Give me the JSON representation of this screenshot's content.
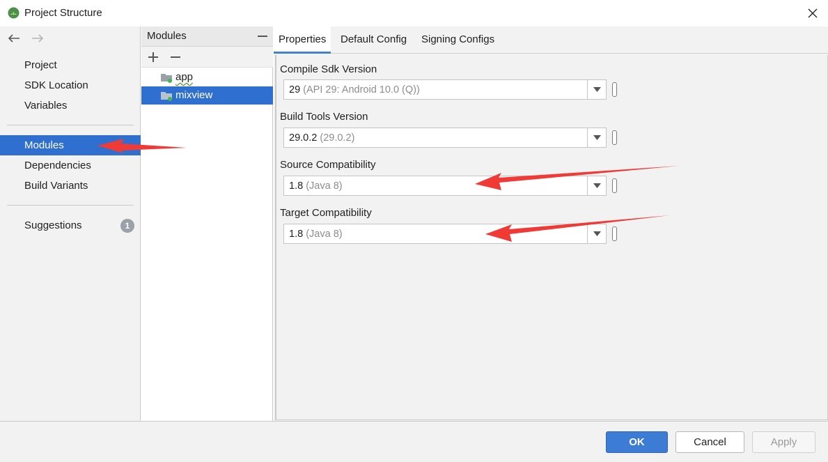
{
  "window": {
    "title": "Project Structure"
  },
  "sidebar": {
    "items": [
      {
        "label": "Project"
      },
      {
        "label": "SDK Location"
      },
      {
        "label": "Variables"
      },
      {
        "label": "Modules",
        "selected": true
      },
      {
        "label": "Dependencies"
      },
      {
        "label": "Build Variants"
      },
      {
        "label": "Suggestions",
        "badge": "1"
      }
    ]
  },
  "modules": {
    "header": "Modules",
    "items": [
      {
        "label": "app"
      },
      {
        "label": "mixview",
        "selected": true
      }
    ]
  },
  "tabs": [
    {
      "label": "Properties",
      "active": true
    },
    {
      "label": "Default Config"
    },
    {
      "label": "Signing Configs"
    }
  ],
  "properties": {
    "compile_sdk": {
      "label": "Compile Sdk Version",
      "value": "29",
      "hint": "(API 29: Android 10.0 (Q))"
    },
    "build_tools": {
      "label": "Build Tools Version",
      "value": "29.0.2",
      "hint": "(29.0.2)"
    },
    "source_compat": {
      "label": "Source Compatibility",
      "value": "1.8",
      "hint": "(Java 8)"
    },
    "target_compat": {
      "label": "Target Compatibility",
      "value": "1.8",
      "hint": "(Java 8)"
    }
  },
  "buttons": {
    "ok": "OK",
    "cancel": "Cancel",
    "apply": "Apply"
  },
  "colors": {
    "selection": "#2f6fcf",
    "primary_button": "#3d7cd4",
    "annotation_arrow": "#f03a36"
  }
}
